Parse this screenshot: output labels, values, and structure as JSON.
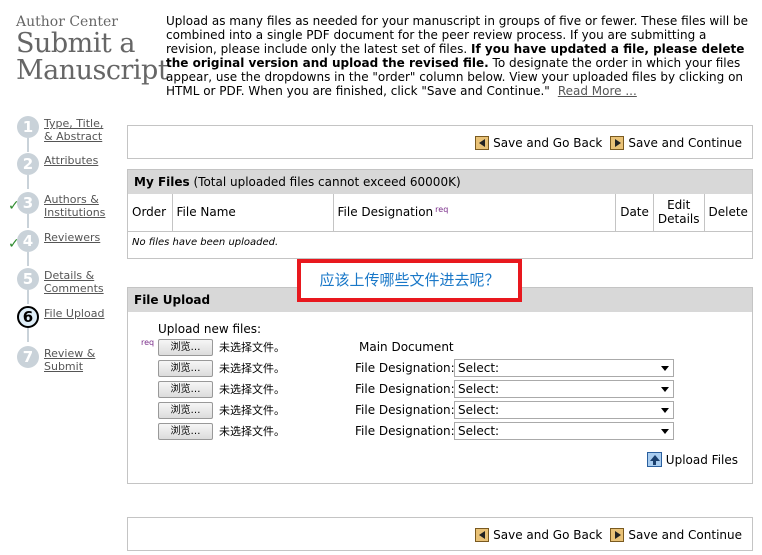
{
  "brand": {
    "small": "Author Center",
    "line1": "Submit a",
    "line2": "Manuscript"
  },
  "intro": {
    "part1": "Upload as many files as needed for your manuscript in groups of five or fewer. These files will be combined into a single PDF document for the peer review process. If you are submitting a revision, please include only the latest set of files. ",
    "bold": "If you have updated a file, please delete the original version and upload the revised file.",
    "part2": " To designate the order in which your files appear, use the dropdowns in the \"order\" column below. View your uploaded files by clicking on HTML or PDF. When you are finished, click \"Save and Continue.\"",
    "read_more": "Read More ..."
  },
  "steps": [
    {
      "num": "1",
      "label_1": "Type, Title,",
      "label_2": "& Abstract",
      "check": ""
    },
    {
      "num": "2",
      "label_1": "Attributes",
      "label_2": "",
      "check": ""
    },
    {
      "num": "3",
      "label_1": "Authors &",
      "label_2": "Institutions",
      "check": "✓"
    },
    {
      "num": "4",
      "label_1": "Reviewers",
      "label_2": "",
      "check": "✓"
    },
    {
      "num": "5",
      "label_1": "Details &",
      "label_2": "Comments",
      "check": ""
    },
    {
      "num": "6",
      "label_1": "File Upload",
      "label_2": "",
      "check": ""
    },
    {
      "num": "7",
      "label_1": "Review &",
      "label_2": "Submit",
      "check": ""
    }
  ],
  "nav": {
    "back": "Save and Go Back",
    "continue": "Save and Continue"
  },
  "my_files": {
    "title": "My Files",
    "note": " (Total uploaded files cannot exceed 60000K)",
    "columns": {
      "order": "Order",
      "name": "File Name",
      "designation": "File Designation",
      "req": "req",
      "date": "Date",
      "edit_1": "Edit",
      "edit_2": "Details",
      "delete": "Delete"
    },
    "empty": "No files have been uploaded."
  },
  "callout": "应该上传哪些文件进去呢？",
  "upload": {
    "title": "File Upload",
    "new_files": "Upload new files:",
    "req": "req",
    "browse": "浏览…",
    "no_file": "未选择文件。",
    "main_doc": "Main Document",
    "designation_label": "File Designation:",
    "select": "Select:",
    "upload_button": "Upload Files"
  }
}
